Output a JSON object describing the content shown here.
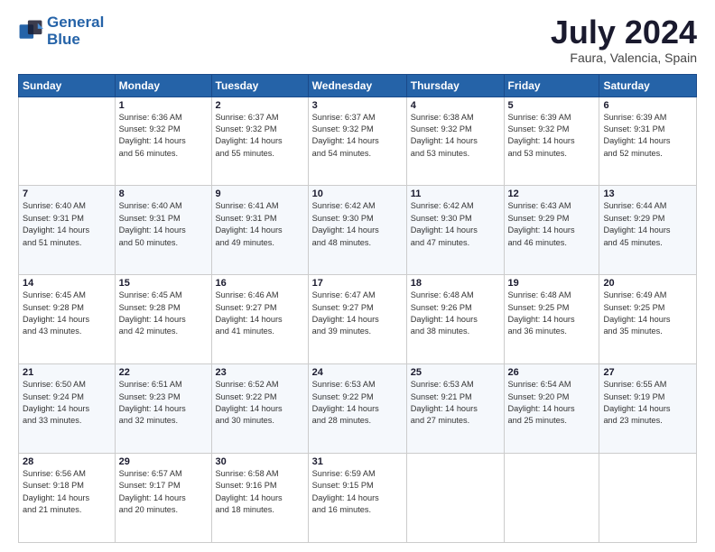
{
  "logo": {
    "line1": "General",
    "line2": "Blue"
  },
  "header": {
    "title": "July 2024",
    "subtitle": "Faura, Valencia, Spain"
  },
  "weekdays": [
    "Sunday",
    "Monday",
    "Tuesday",
    "Wednesday",
    "Thursday",
    "Friday",
    "Saturday"
  ],
  "weeks": [
    [
      {
        "day": "",
        "info": ""
      },
      {
        "day": "1",
        "info": "Sunrise: 6:36 AM\nSunset: 9:32 PM\nDaylight: 14 hours\nand 56 minutes."
      },
      {
        "day": "2",
        "info": "Sunrise: 6:37 AM\nSunset: 9:32 PM\nDaylight: 14 hours\nand 55 minutes."
      },
      {
        "day": "3",
        "info": "Sunrise: 6:37 AM\nSunset: 9:32 PM\nDaylight: 14 hours\nand 54 minutes."
      },
      {
        "day": "4",
        "info": "Sunrise: 6:38 AM\nSunset: 9:32 PM\nDaylight: 14 hours\nand 53 minutes."
      },
      {
        "day": "5",
        "info": "Sunrise: 6:39 AM\nSunset: 9:32 PM\nDaylight: 14 hours\nand 53 minutes."
      },
      {
        "day": "6",
        "info": "Sunrise: 6:39 AM\nSunset: 9:31 PM\nDaylight: 14 hours\nand 52 minutes."
      }
    ],
    [
      {
        "day": "7",
        "info": "Sunrise: 6:40 AM\nSunset: 9:31 PM\nDaylight: 14 hours\nand 51 minutes."
      },
      {
        "day": "8",
        "info": "Sunrise: 6:40 AM\nSunset: 9:31 PM\nDaylight: 14 hours\nand 50 minutes."
      },
      {
        "day": "9",
        "info": "Sunrise: 6:41 AM\nSunset: 9:31 PM\nDaylight: 14 hours\nand 49 minutes."
      },
      {
        "day": "10",
        "info": "Sunrise: 6:42 AM\nSunset: 9:30 PM\nDaylight: 14 hours\nand 48 minutes."
      },
      {
        "day": "11",
        "info": "Sunrise: 6:42 AM\nSunset: 9:30 PM\nDaylight: 14 hours\nand 47 minutes."
      },
      {
        "day": "12",
        "info": "Sunrise: 6:43 AM\nSunset: 9:29 PM\nDaylight: 14 hours\nand 46 minutes."
      },
      {
        "day": "13",
        "info": "Sunrise: 6:44 AM\nSunset: 9:29 PM\nDaylight: 14 hours\nand 45 minutes."
      }
    ],
    [
      {
        "day": "14",
        "info": "Sunrise: 6:45 AM\nSunset: 9:28 PM\nDaylight: 14 hours\nand 43 minutes."
      },
      {
        "day": "15",
        "info": "Sunrise: 6:45 AM\nSunset: 9:28 PM\nDaylight: 14 hours\nand 42 minutes."
      },
      {
        "day": "16",
        "info": "Sunrise: 6:46 AM\nSunset: 9:27 PM\nDaylight: 14 hours\nand 41 minutes."
      },
      {
        "day": "17",
        "info": "Sunrise: 6:47 AM\nSunset: 9:27 PM\nDaylight: 14 hours\nand 39 minutes."
      },
      {
        "day": "18",
        "info": "Sunrise: 6:48 AM\nSunset: 9:26 PM\nDaylight: 14 hours\nand 38 minutes."
      },
      {
        "day": "19",
        "info": "Sunrise: 6:48 AM\nSunset: 9:25 PM\nDaylight: 14 hours\nand 36 minutes."
      },
      {
        "day": "20",
        "info": "Sunrise: 6:49 AM\nSunset: 9:25 PM\nDaylight: 14 hours\nand 35 minutes."
      }
    ],
    [
      {
        "day": "21",
        "info": "Sunrise: 6:50 AM\nSunset: 9:24 PM\nDaylight: 14 hours\nand 33 minutes."
      },
      {
        "day": "22",
        "info": "Sunrise: 6:51 AM\nSunset: 9:23 PM\nDaylight: 14 hours\nand 32 minutes."
      },
      {
        "day": "23",
        "info": "Sunrise: 6:52 AM\nSunset: 9:22 PM\nDaylight: 14 hours\nand 30 minutes."
      },
      {
        "day": "24",
        "info": "Sunrise: 6:53 AM\nSunset: 9:22 PM\nDaylight: 14 hours\nand 28 minutes."
      },
      {
        "day": "25",
        "info": "Sunrise: 6:53 AM\nSunset: 9:21 PM\nDaylight: 14 hours\nand 27 minutes."
      },
      {
        "day": "26",
        "info": "Sunrise: 6:54 AM\nSunset: 9:20 PM\nDaylight: 14 hours\nand 25 minutes."
      },
      {
        "day": "27",
        "info": "Sunrise: 6:55 AM\nSunset: 9:19 PM\nDaylight: 14 hours\nand 23 minutes."
      }
    ],
    [
      {
        "day": "28",
        "info": "Sunrise: 6:56 AM\nSunset: 9:18 PM\nDaylight: 14 hours\nand 21 minutes."
      },
      {
        "day": "29",
        "info": "Sunrise: 6:57 AM\nSunset: 9:17 PM\nDaylight: 14 hours\nand 20 minutes."
      },
      {
        "day": "30",
        "info": "Sunrise: 6:58 AM\nSunset: 9:16 PM\nDaylight: 14 hours\nand 18 minutes."
      },
      {
        "day": "31",
        "info": "Sunrise: 6:59 AM\nSunset: 9:15 PM\nDaylight: 14 hours\nand 16 minutes."
      },
      {
        "day": "",
        "info": ""
      },
      {
        "day": "",
        "info": ""
      },
      {
        "day": "",
        "info": ""
      }
    ]
  ]
}
